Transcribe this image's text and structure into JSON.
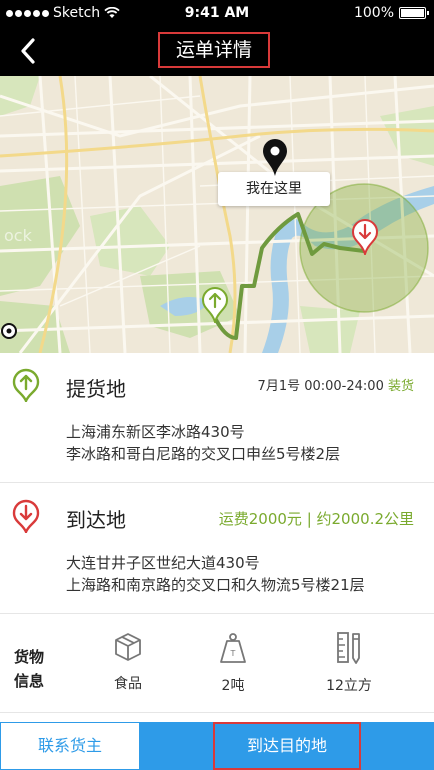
{
  "status_bar": {
    "carrier": "Sketch",
    "time": "9:41 AM",
    "battery": "100%"
  },
  "header": {
    "title": "运单详情"
  },
  "map": {
    "current_location_label": "我在这里",
    "watermark": "ock"
  },
  "pickup": {
    "title": "提货地",
    "time": "7月1号 00:00-24:00",
    "status": "装货",
    "address_line1": "上海浦东新区李冰路430号",
    "address_line2": "李冰路和哥白尼路的交叉口申丝5号楼2层"
  },
  "dropoff": {
    "title": "到达地",
    "fee": "运费2000元 | 约2000.2公里",
    "address_line1": "大连甘井子区世纪大道430号",
    "address_line2": "上海路和南京路的交叉口和久物流5号楼21层"
  },
  "cargo": {
    "label_line1": "货物",
    "label_line2": "信息",
    "items": [
      {
        "icon": "box-icon",
        "value": "食品"
      },
      {
        "icon": "weight-icon",
        "value": "2吨"
      },
      {
        "icon": "ruler-icon",
        "value": "12立方"
      }
    ]
  },
  "actions": {
    "contact": "联系货主",
    "arrive": "到达目的地"
  },
  "colors": {
    "accent_blue": "#2e9be8",
    "accent_green": "#7aaa2e",
    "alert_red": "#d93a3a"
  }
}
